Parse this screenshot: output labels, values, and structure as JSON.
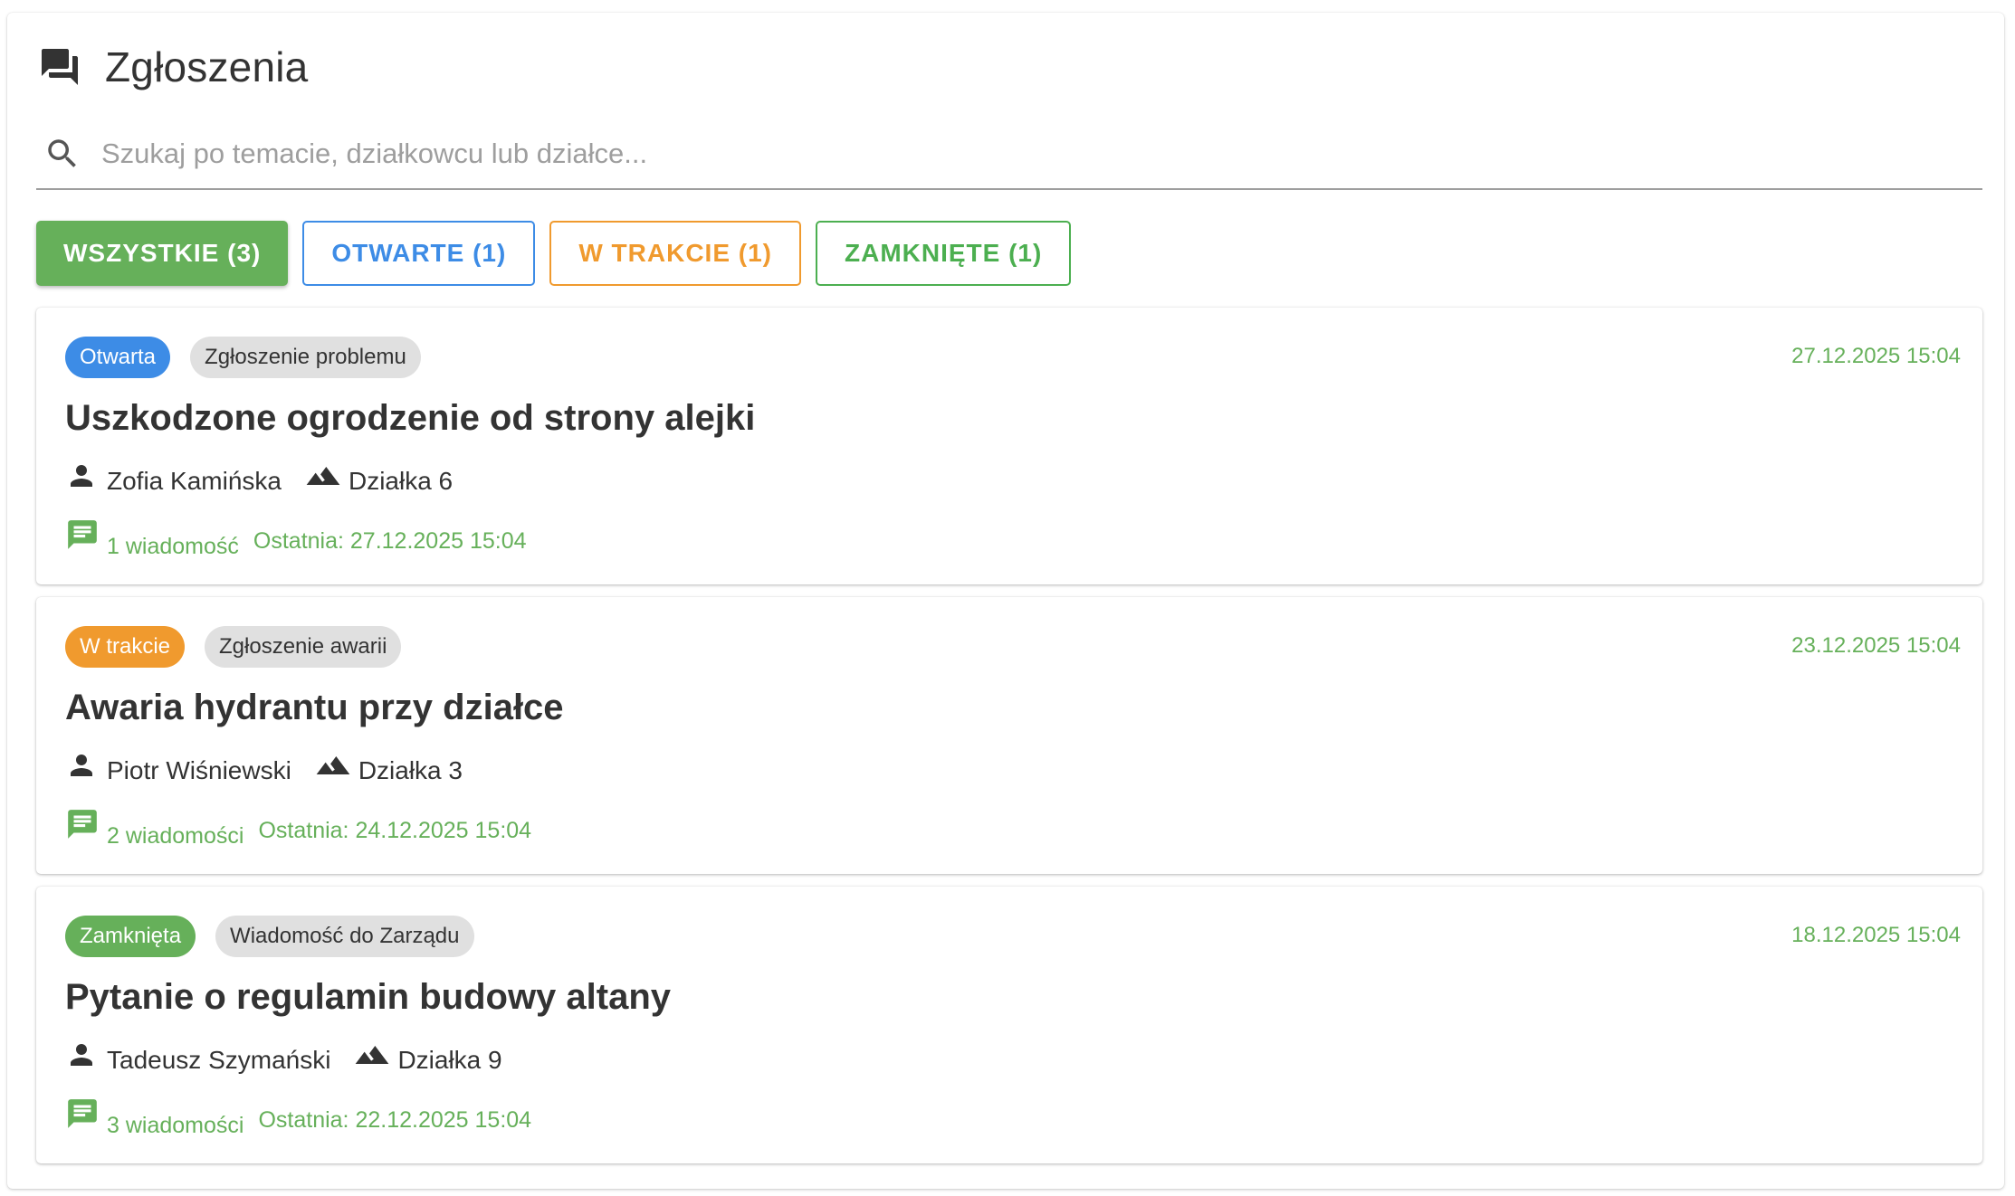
{
  "header": {
    "title": "Zgłoszenia",
    "icon": "forum-icon"
  },
  "search": {
    "placeholder": "Szukaj po temacie, działkowcu lub działce...",
    "value": ""
  },
  "filters": [
    {
      "label": "WSZYSTKIE (3)",
      "active": true,
      "color": "#66b05a"
    },
    {
      "label": "OTWARTE (1)",
      "active": false,
      "color": "#3d8ce6"
    },
    {
      "label": "W TRAKCIE (1)",
      "active": false,
      "color": "#f09a2e"
    },
    {
      "label": "ZAMKNIĘTE (1)",
      "active": false,
      "color": "#4caf50"
    }
  ],
  "tickets": [
    {
      "status": "Otwarta",
      "status_color": "#3d8ce6",
      "category": "Zgłoszenie problemu",
      "date": "27.12.2025 15:04",
      "title": "Uszkodzone ogrodzenie od strony alejki",
      "user": "Zofia Kamińska",
      "plot": "Działka 6",
      "messages": "1 wiadomość",
      "last": "Ostatnia: 27.12.2025 15:04"
    },
    {
      "status": "W trakcie",
      "status_color": "#f09a2e",
      "category": "Zgłoszenie awarii",
      "date": "23.12.2025 15:04",
      "title": "Awaria hydrantu przy działce",
      "user": "Piotr Wiśniewski",
      "plot": "Działka 3",
      "messages": "2 wiadomości",
      "last": "Ostatnia: 24.12.2025 15:04"
    },
    {
      "status": "Zamknięta",
      "status_color": "#66b05a",
      "category": "Wiadomość do Zarządu",
      "date": "18.12.2025 15:04",
      "title": "Pytanie o regulamin budowy altany",
      "user": "Tadeusz Szymański",
      "plot": "Działka 9",
      "messages": "3 wiadomości",
      "last": "Ostatnia: 22.12.2025 15:04"
    }
  ]
}
